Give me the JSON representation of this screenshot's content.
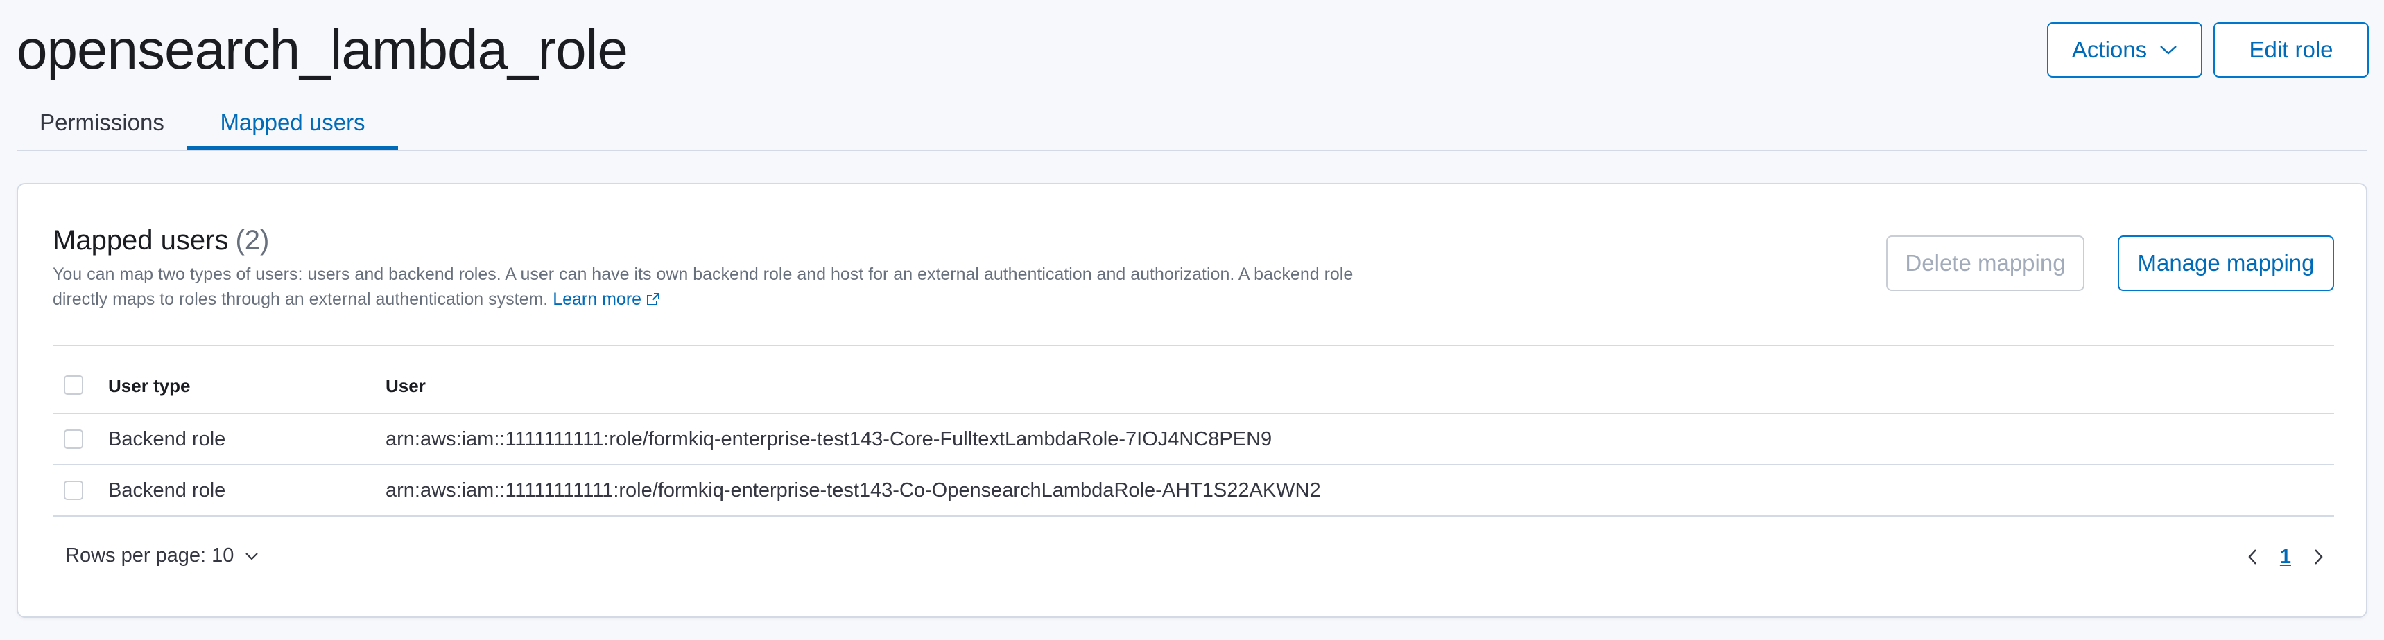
{
  "header": {
    "title": "opensearch_lambda_role",
    "actions_label": "Actions",
    "edit_role_label": "Edit role"
  },
  "tabs": [
    {
      "label": "Permissions",
      "active": false
    },
    {
      "label": "Mapped users",
      "active": true
    }
  ],
  "panel": {
    "title": "Mapped users",
    "count": "(2)",
    "description": "You can map two types of users: users and backend roles. A user can have its own backend role and host for an external authentication and authorization. A backend role directly maps to roles through an external authentication system.",
    "learn_more": "Learn more",
    "delete_mapping_label": "Delete mapping",
    "manage_mapping_label": "Manage mapping"
  },
  "table": {
    "columns": [
      "User type",
      "User"
    ],
    "rows": [
      {
        "user_type": "Backend role",
        "user": "arn:aws:iam::1111111111:role/formkiq-enterprise-test143-Core-FulltextLambdaRole-7IOJ4NC8PEN9"
      },
      {
        "user_type": "Backend role",
        "user": "arn:aws:iam::11111111111:role/formkiq-enterprise-test143-Co-OpensearchLambdaRole-AHT1S22AKWN2"
      }
    ]
  },
  "pagination": {
    "rows_per_page_label": "Rows per page: 10",
    "current_page": "1"
  },
  "colors": {
    "accent": "#006bb8",
    "border": "#d3dae6",
    "background": "#f7f8fc"
  },
  "icons": {
    "actions_chevron": "chevron-down-icon",
    "external_link": "external-link-icon",
    "rows_chevron": "chevron-down-icon",
    "prev": "chevron-left-icon",
    "next": "chevron-right-icon"
  }
}
